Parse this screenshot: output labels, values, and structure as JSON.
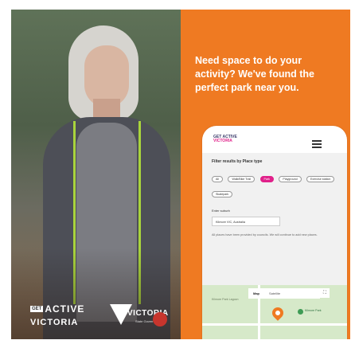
{
  "headline": "Need space to do your activity? We've found the perfect park near you.",
  "logos": {
    "gav_get": "GET",
    "gav_active": "ACTIVE",
    "gav_victoria": "VICTORIA",
    "vic_word": "VICTORIA",
    "vic_sub": "State Government"
  },
  "app": {
    "logo_line1": "GET ACTIVE",
    "logo_line2": "VICTORIA",
    "menu_icon": "hamburger-icon",
    "filter_title": "Filter results by Place type",
    "chips": [
      {
        "label": "All",
        "active": false
      },
      {
        "label": "Walk/Bike Trail",
        "active": false
      },
      {
        "label": "Park",
        "active": true
      },
      {
        "label": "Playground",
        "active": false
      },
      {
        "label": "Exercise station",
        "active": false
      },
      {
        "label": "Skatepark",
        "active": false
      }
    ],
    "suburb_label": "Enter suburb",
    "suburb_value": "Kilmore VIC, Australia",
    "note": "All places have been provided by councils. We will continue to add new places.",
    "map_tabs": [
      "Map",
      "Satellite"
    ],
    "map_place": "Kilmore Park",
    "map_area": "Kilmore Park Lagoon",
    "accent": "#ef7a22",
    "chip_active_color": "#e0218a"
  }
}
